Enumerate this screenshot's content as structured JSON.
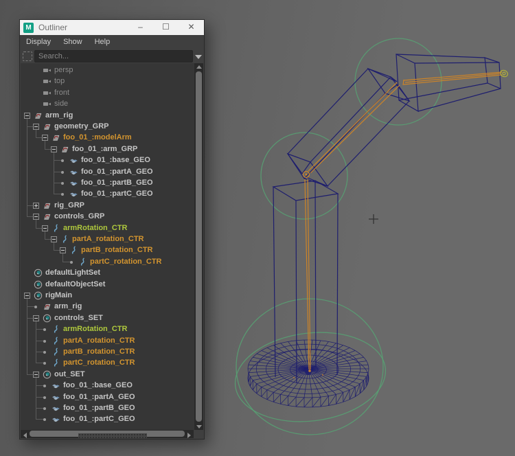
{
  "window": {
    "title": "Outliner",
    "logo_text": "M",
    "buttons": {
      "minimize": "–",
      "maximize": "☐",
      "close": "✕"
    }
  },
  "menus": [
    "Display",
    "Show",
    "Help"
  ],
  "search": {
    "placeholder": "Search..."
  },
  "tree": {
    "rows": [
      {
        "indent": 1,
        "icon": "camera",
        "label": "persp",
        "color": "dim",
        "exp": null,
        "connect": false
      },
      {
        "indent": 1,
        "icon": "camera",
        "label": "top",
        "color": "dim",
        "exp": null,
        "connect": false
      },
      {
        "indent": 1,
        "icon": "camera",
        "label": "front",
        "color": "dim",
        "exp": null,
        "connect": false
      },
      {
        "indent": 1,
        "icon": "camera",
        "label": "side",
        "color": "dim",
        "exp": null,
        "connect": false
      },
      {
        "indent": 0,
        "icon": "transform",
        "label": "arm_rig",
        "color": "default",
        "exp": "minus"
      },
      {
        "indent": 1,
        "icon": "transform",
        "label": "geometry_GRP",
        "color": "default",
        "exp": "minus"
      },
      {
        "indent": 2,
        "icon": "transform",
        "label": "foo_01_:modelArm",
        "color": "orange",
        "exp": "minus"
      },
      {
        "indent": 3,
        "icon": "transform",
        "label": "foo_01_:arm_GRP",
        "color": "default",
        "exp": "minus"
      },
      {
        "indent": 4,
        "icon": "mesh",
        "label": "foo_01_:base_GEO",
        "color": "default",
        "exp": "dot"
      },
      {
        "indent": 4,
        "icon": "mesh",
        "label": "foo_01_:partA_GEO",
        "color": "default",
        "exp": "dot"
      },
      {
        "indent": 4,
        "icon": "mesh",
        "label": "foo_01_:partB_GEO",
        "color": "default",
        "exp": "dot"
      },
      {
        "indent": 4,
        "icon": "mesh",
        "label": "foo_01_:partC_GEO",
        "color": "default",
        "exp": "dot"
      },
      {
        "indent": 1,
        "icon": "transform",
        "label": "rig_GRP",
        "color": "default",
        "exp": "plus"
      },
      {
        "indent": 1,
        "icon": "transform",
        "label": "controls_GRP",
        "color": "default",
        "exp": "minus"
      },
      {
        "indent": 2,
        "icon": "curve",
        "label": "armRotation_CTR",
        "color": "green",
        "exp": "minus"
      },
      {
        "indent": 3,
        "icon": "curve",
        "label": "partA_rotation_CTR",
        "color": "orange",
        "exp": "minus"
      },
      {
        "indent": 4,
        "icon": "curve",
        "label": "partB_rotation_CTR",
        "color": "orange",
        "exp": "minus"
      },
      {
        "indent": 5,
        "icon": "curve",
        "label": "partC_rotation_CTR",
        "color": "orange",
        "exp": "dot"
      },
      {
        "indent": 0,
        "icon": "set",
        "label": "defaultLightSet",
        "color": "default",
        "exp": null
      },
      {
        "indent": 0,
        "icon": "set",
        "label": "defaultObjectSet",
        "color": "default",
        "exp": null
      },
      {
        "indent": 0,
        "icon": "set",
        "label": "rigMain",
        "color": "default",
        "exp": "minus"
      },
      {
        "indent": 1,
        "icon": "transform",
        "label": "arm_rig",
        "color": "default",
        "exp": "dot"
      },
      {
        "indent": 1,
        "icon": "set",
        "label": "controls_SET",
        "color": "default",
        "exp": "minus"
      },
      {
        "indent": 2,
        "icon": "curve",
        "label": "armRotation_CTR",
        "color": "green",
        "exp": "dot"
      },
      {
        "indent": 2,
        "icon": "curve",
        "label": "partA_rotation_CTR",
        "color": "orange",
        "exp": "dot"
      },
      {
        "indent": 2,
        "icon": "curve",
        "label": "partB_rotation_CTR",
        "color": "orange",
        "exp": "dot"
      },
      {
        "indent": 2,
        "icon": "curve",
        "label": "partC_rotation_CTR",
        "color": "orange",
        "exp": "dot"
      },
      {
        "indent": 1,
        "icon": "set",
        "label": "out_SET",
        "color": "default",
        "exp": "minus"
      },
      {
        "indent": 2,
        "icon": "mesh",
        "label": "foo_01_:base_GEO",
        "color": "default",
        "exp": "dot"
      },
      {
        "indent": 2,
        "icon": "mesh",
        "label": "foo_01_:partA_GEO",
        "color": "default",
        "exp": "dot"
      },
      {
        "indent": 2,
        "icon": "mesh",
        "label": "foo_01_:partB_GEO",
        "color": "default",
        "exp": "dot"
      },
      {
        "indent": 2,
        "icon": "mesh",
        "label": "foo_01_:partC_GEO",
        "color": "default",
        "exp": "dot"
      }
    ]
  },
  "colors": {
    "accent_teal": "#14a085",
    "field_bg": "#2a2a2a",
    "text_default": "#c6c6c6",
    "text_dim": "#8b8b8b",
    "text_orange": "#d2942f",
    "text_green": "#aec73d",
    "wire_navy": "#1e1e6e",
    "wire_orange": "#cd8428",
    "wire_green": "#57a273",
    "wire_olive": "#b2b23a",
    "scroll_thumb": "#6e6e6e",
    "scroll_track": "#2a2a2a"
  }
}
